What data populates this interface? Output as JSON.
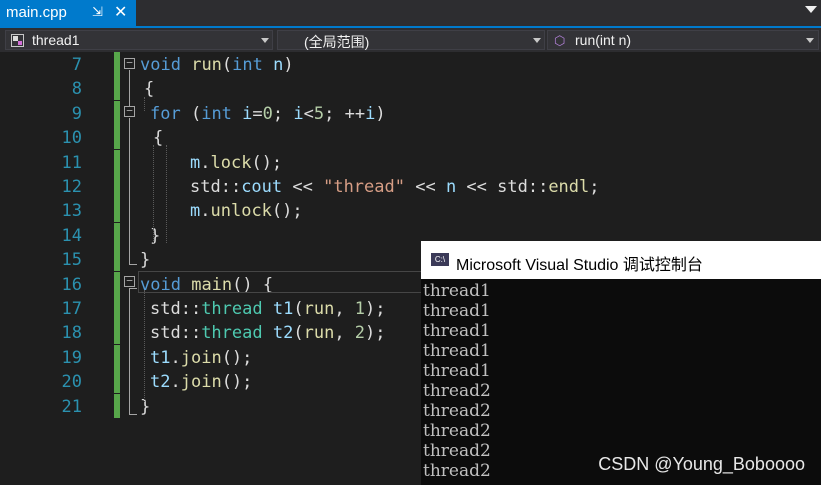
{
  "tab": {
    "filename": "main.cpp",
    "pin_icon": "pin-icon",
    "close_icon": "close-icon"
  },
  "navbar": {
    "project": "thread1",
    "scope": "(全局范围)",
    "member": "run(int n)"
  },
  "editor": {
    "line_numbers": [
      "7",
      "8",
      "9",
      "10",
      "11",
      "12",
      "13",
      "14",
      "15",
      "16",
      "17",
      "18",
      "19",
      "20",
      "21"
    ],
    "lines": [
      [
        [
          "kw",
          "void"
        ],
        [
          "pl",
          " "
        ],
        [
          "fn",
          "run"
        ],
        [
          "pl",
          "("
        ],
        [
          "kw",
          "int"
        ],
        [
          "pl",
          " "
        ],
        [
          "var",
          "n"
        ],
        [
          "pl",
          ")"
        ]
      ],
      [
        [
          "pl",
          "{"
        ]
      ],
      [
        [
          "kw",
          "for"
        ],
        [
          "pl",
          " ("
        ],
        [
          "kw",
          "int"
        ],
        [
          "pl",
          " "
        ],
        [
          "var",
          "i"
        ],
        [
          "pl",
          "="
        ],
        [
          "num",
          "0"
        ],
        [
          "pl",
          "; "
        ],
        [
          "var",
          "i"
        ],
        [
          "pl",
          "<"
        ],
        [
          "num",
          "5"
        ],
        [
          "pl",
          "; ++"
        ],
        [
          "var",
          "i"
        ],
        [
          "pl",
          ")"
        ]
      ],
      [
        [
          "pl",
          "{"
        ]
      ],
      [
        [
          "var",
          "m"
        ],
        [
          "pl",
          "."
        ],
        [
          "fn",
          "lock"
        ],
        [
          "pl",
          "();"
        ]
      ],
      [
        [
          "pl",
          "std::"
        ],
        [
          "var",
          "cout"
        ],
        [
          "pl",
          " << "
        ],
        [
          "str",
          "\"thread\""
        ],
        [
          "pl",
          " << "
        ],
        [
          "var",
          "n"
        ],
        [
          "pl",
          " << std::"
        ],
        [
          "fn",
          "endl"
        ],
        [
          "pl",
          ";"
        ]
      ],
      [
        [
          "var",
          "m"
        ],
        [
          "pl",
          "."
        ],
        [
          "fn",
          "unlock"
        ],
        [
          "pl",
          "();"
        ]
      ],
      [
        [
          "pl",
          "}"
        ]
      ],
      [
        [
          "pl",
          "}"
        ]
      ],
      [
        [
          "kw",
          "void"
        ],
        [
          "pl",
          " "
        ],
        [
          "fn",
          "main"
        ],
        [
          "pl",
          "() {"
        ]
      ],
      [
        [
          "pl",
          "std::"
        ],
        [
          "ty",
          "thread"
        ],
        [
          "pl",
          " "
        ],
        [
          "var",
          "t1"
        ],
        [
          "pl",
          "("
        ],
        [
          "fn",
          "run"
        ],
        [
          "pl",
          ", "
        ],
        [
          "num",
          "1"
        ],
        [
          "pl",
          ");"
        ]
      ],
      [
        [
          "pl",
          "std::"
        ],
        [
          "ty",
          "thread"
        ],
        [
          "pl",
          " "
        ],
        [
          "var",
          "t2"
        ],
        [
          "pl",
          "("
        ],
        [
          "fn",
          "run"
        ],
        [
          "pl",
          ", "
        ],
        [
          "num",
          "2"
        ],
        [
          "pl",
          ");"
        ]
      ],
      [
        [
          "var",
          "t1"
        ],
        [
          "pl",
          "."
        ],
        [
          "fn",
          "join"
        ],
        [
          "pl",
          "();"
        ]
      ],
      [
        [
          "var",
          "t2"
        ],
        [
          "pl",
          "."
        ],
        [
          "fn",
          "join"
        ],
        [
          "pl",
          "();"
        ]
      ],
      [
        [
          "pl",
          "}"
        ]
      ]
    ]
  },
  "console": {
    "title": "Microsoft Visual Studio 调试控制台",
    "icon_text": "C:\\",
    "output": [
      "thread1",
      "thread1",
      "thread1",
      "thread1",
      "thread1",
      "thread2",
      "thread2",
      "thread2",
      "thread2",
      "thread2"
    ]
  },
  "watermark": "CSDN @Young_Boboooo",
  "colors": {
    "accent": "#007acc",
    "changebar": "#57a64a",
    "keyword": "#569cd6",
    "function": "#dcdcaa",
    "type": "#4ec9b0",
    "string": "#d69d85"
  }
}
